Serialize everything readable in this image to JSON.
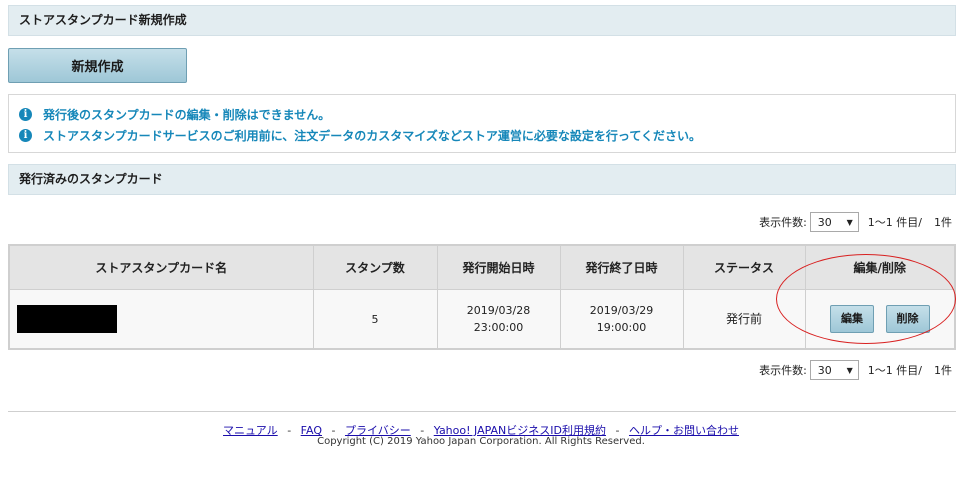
{
  "new_section": {
    "title": "ストアスタンプカード新規作成",
    "create_button": "新規作成"
  },
  "notices": [
    {
      "icon": "info-icon",
      "text": "発行後のスタンプカードの編集・削除はできません。"
    },
    {
      "icon": "info-icon",
      "text": "ストアスタンプカードサービスのご利用前に、注文データのカスタマイズなどストア運営に必要な設定を行ってください。"
    }
  ],
  "issued_section": {
    "title": "発行済みのスタンプカード"
  },
  "pager_top": {
    "label": "表示件数:",
    "selected": "30",
    "range": "1〜1 件目/",
    "total": "1件"
  },
  "pager_bottom": {
    "label": "表示件数:",
    "selected": "30",
    "range": "1〜1 件目/",
    "total": "1件"
  },
  "table": {
    "headers": [
      "ストアスタンプカード名",
      "スタンプ数",
      "発行開始日時",
      "発行終了日時",
      "ステータス",
      "編集/削除"
    ],
    "rows": [
      {
        "name": "",
        "stamps": "5",
        "start_date": "2019/03/28",
        "start_time": "23:00:00",
        "end_date": "2019/03/29",
        "end_time": "19:00:00",
        "status": "発行前",
        "edit_label": "編集",
        "delete_label": "削除"
      }
    ]
  },
  "annotation": {
    "color": "#d82020"
  },
  "footer": {
    "links": [
      "マニュアル",
      "FAQ",
      "プライバシー",
      "Yahoo! JAPANビジネスID利用規約",
      "ヘルプ・お問い合わせ"
    ],
    "separator": "-",
    "copyright": "Copyright (C) 2019 Yahoo Japan Corporation. All Rights Reserved."
  }
}
